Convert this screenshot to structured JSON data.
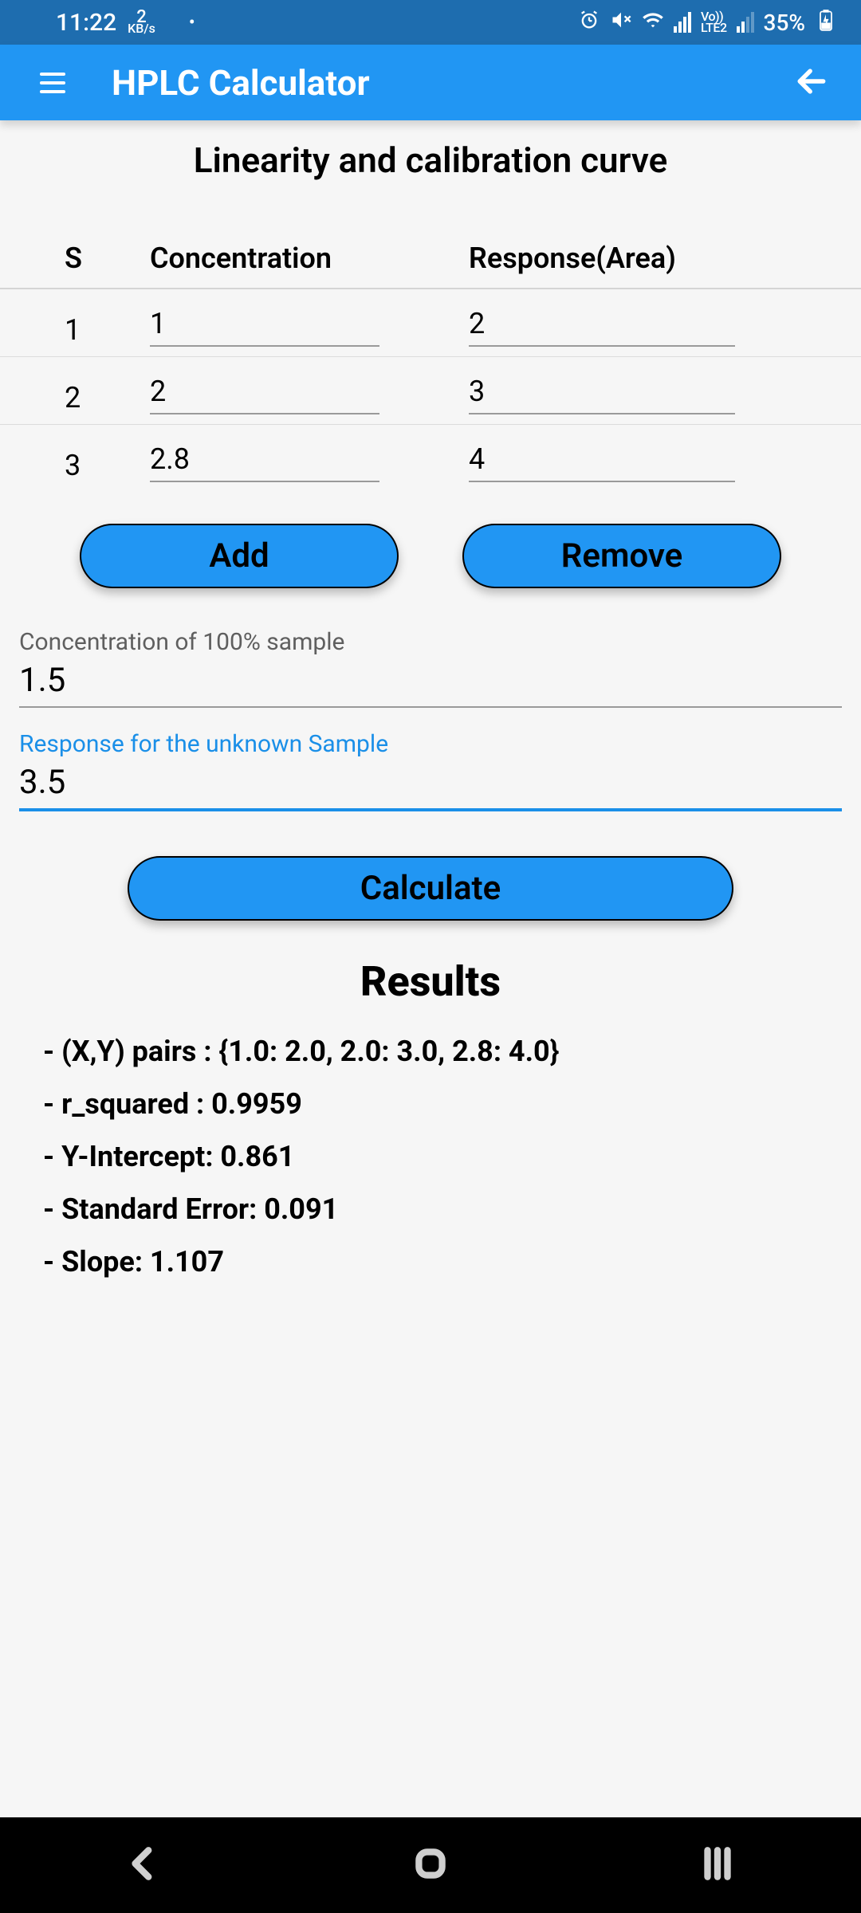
{
  "status": {
    "time": "11:22",
    "kbps_top": "2",
    "kbps_bottom": "KB/s",
    "battery": "35%",
    "lte": "LTE2",
    "vo": "Vo))"
  },
  "appbar": {
    "title": "HPLC Calculator"
  },
  "page_title": "Linearity and calibration curve",
  "table": {
    "headers": {
      "s": "S",
      "c1": "Concentration",
      "c2": "Response(Area)"
    },
    "rows": [
      {
        "s": "1",
        "c1": "1",
        "c2": "2"
      },
      {
        "s": "2",
        "c1": "2",
        "c2": "3"
      },
      {
        "s": "3",
        "c1": "2.8",
        "c2": "4"
      }
    ]
  },
  "buttons": {
    "add": "Add",
    "remove": "Remove",
    "calculate": "Calculate"
  },
  "fields": {
    "conc100_label": "Concentration of 100% sample",
    "conc100_value": "1.5",
    "resp_unknown_label": "Response for the unknown Sample",
    "resp_unknown_value": "3.5"
  },
  "results": {
    "title": "Results",
    "lines": [
      "- (X,Y) pairs : {1.0: 2.0, 2.0: 3.0, 2.8: 4.0}",
      "- r_squared : 0.9959",
      "- Y-Intercept: 0.861",
      "- Standard Error: 0.091",
      "- Slope: 1.107"
    ]
  }
}
